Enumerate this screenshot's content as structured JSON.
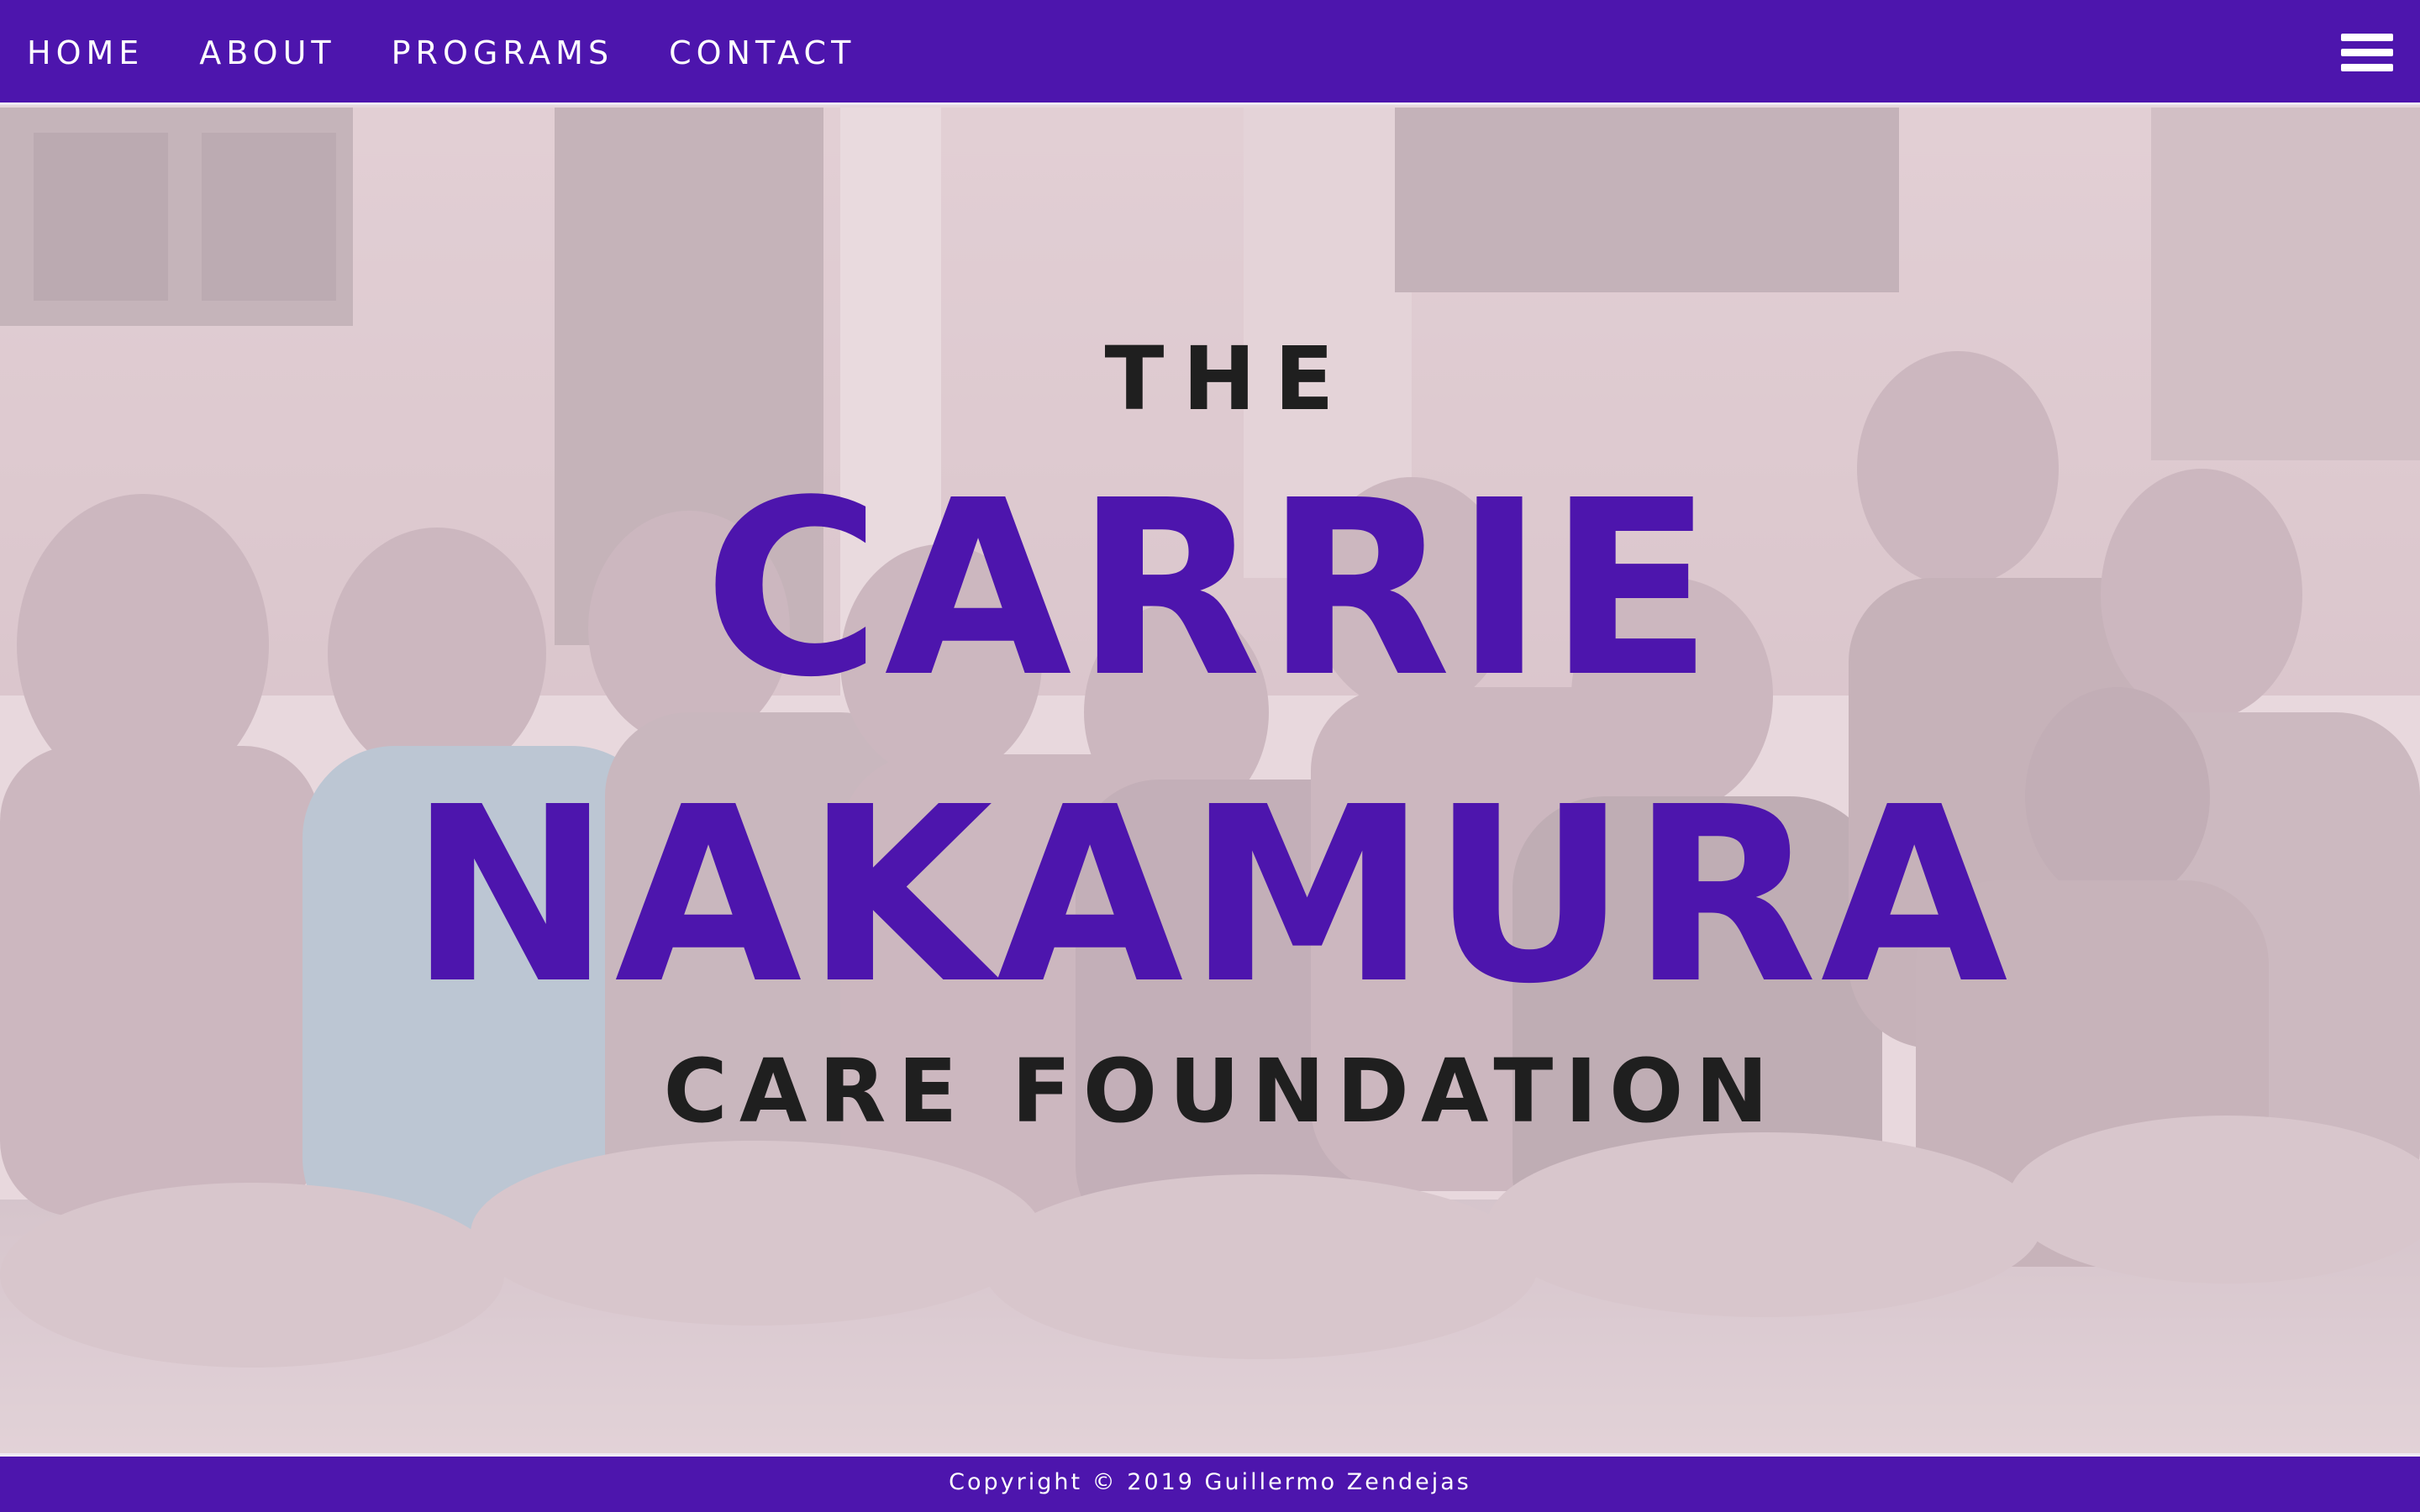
{
  "nav": {
    "links": [
      {
        "label": "HOME"
      },
      {
        "label": "ABOUT"
      },
      {
        "label": "PROGRAMS"
      },
      {
        "label": "CONTACT"
      }
    ],
    "menu_icon": "hamburger-menu-icon"
  },
  "hero": {
    "line1": "THE",
    "line2": "CARRIE",
    "line3": "NAKAMURA",
    "line4": "CARE FOUNDATION",
    "image": "photo of children sitting on a floor"
  },
  "footer": {
    "copyright": "Copyright © 2019 Guillermo Zendejas"
  },
  "colors": {
    "brand_purple": "#4d15ad",
    "title_dark": "#1f1f1f",
    "white": "#ffffff"
  }
}
